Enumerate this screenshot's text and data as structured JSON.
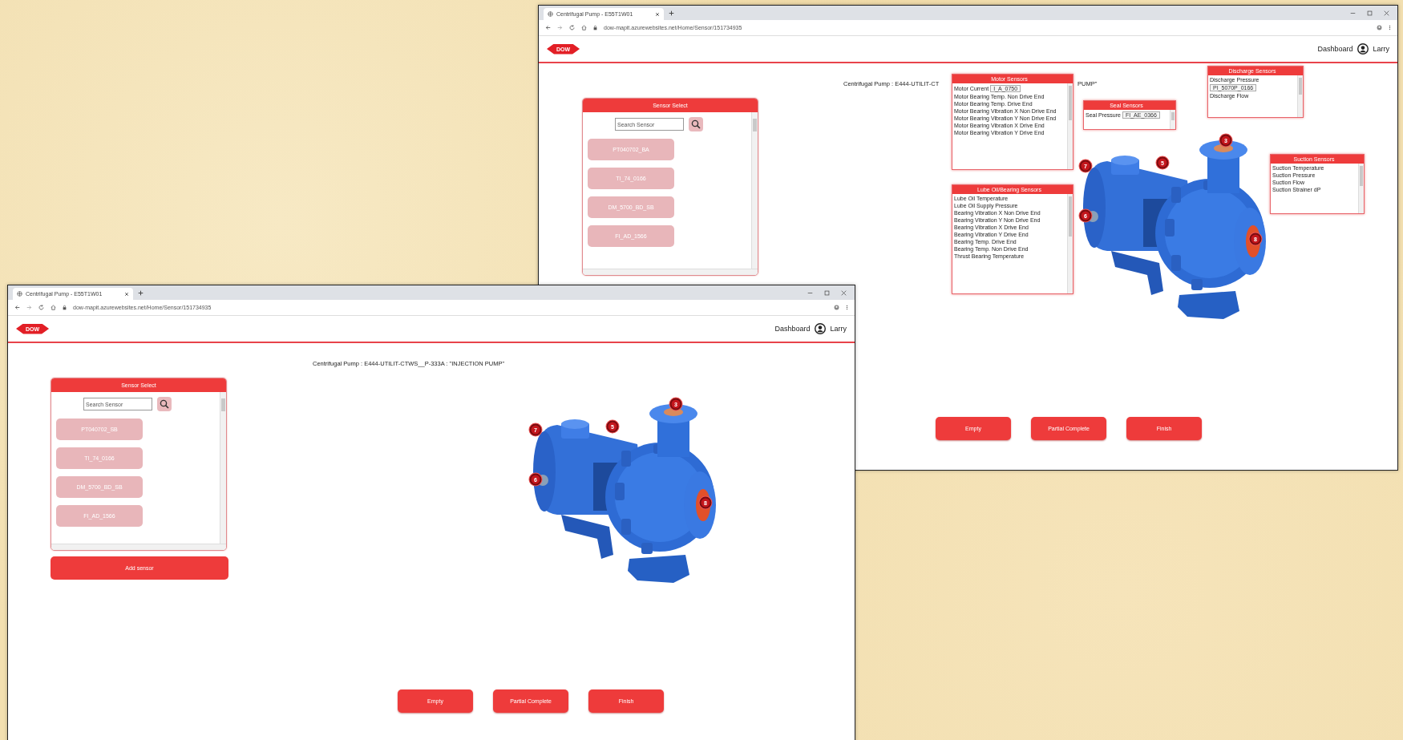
{
  "back_window": {
    "tab_title": "Centrifugal Pump - E55T1W01",
    "url": "dow-mapit.azurewebsites.net/Home/Sensor/151734935",
    "logo": "DOW",
    "nav_link": "Dashboard",
    "user_name": "Larry",
    "page_title": "Centrifugal Pump : E444-UTILIT-CT",
    "page_title_tail": "PUMP\"",
    "sensor_select": {
      "heading": "Sensor Select",
      "placeholder": "Search Sensor",
      "sensors": [
        "PT040702_BA",
        "TI_74_0166",
        "DM_5700_BD_SB",
        "FI_AD_1566"
      ]
    },
    "pump": {
      "markers": [
        "7",
        "5",
        "3",
        "6",
        "8"
      ],
      "panels": [
        {
          "title": "Motor Sensors",
          "items": [
            {
              "kind": "field",
              "label": "Motor Current",
              "value": "I_A_0750"
            },
            {
              "kind": "text",
              "label": "Motor Bearing Temp. Non Drive End"
            },
            {
              "kind": "text",
              "label": "Motor Bearing Temp. Drive End"
            },
            {
              "kind": "text",
              "label": "Motor Bearing Vibration X Non Drive End"
            },
            {
              "kind": "text",
              "label": "Motor Bearing Vibration Y Non Drive End"
            },
            {
              "kind": "text",
              "label": "Motor Bearing Vibration X Drive End"
            },
            {
              "kind": "text",
              "label": "Motor Bearing Vibration Y Drive End"
            }
          ]
        },
        {
          "title": "Seal Sensors",
          "items": [
            {
              "kind": "field",
              "label": "Seal Pressure",
              "value": "FI_AE_0366"
            }
          ]
        },
        {
          "title": "Discharge Sensors",
          "items": [
            {
              "kind": "field",
              "label": "Discharge Pressure",
              "value": "PI_5070P_0166"
            },
            {
              "kind": "text",
              "label": "Discharge Flow"
            }
          ]
        },
        {
          "title": "Suction Sensors",
          "items": [
            {
              "kind": "text",
              "label": "Suction Temperature"
            },
            {
              "kind": "text",
              "label": "Suction Pressure"
            },
            {
              "kind": "text",
              "label": "Suction Flow"
            },
            {
              "kind": "text",
              "label": "Suction Strainer dP"
            }
          ]
        },
        {
          "title": "Lube Oil/Bearing Sensors",
          "items": [
            {
              "kind": "text",
              "label": "Lube Oil Temperature"
            },
            {
              "kind": "text",
              "label": "Lube Oil Supply Pressure"
            },
            {
              "kind": "text",
              "label": "Bearing Vibration X Non Drive End"
            },
            {
              "kind": "text",
              "label": "Bearing Vibration Y Non Drive End"
            },
            {
              "kind": "text",
              "label": "Bearing Vibration X Drive End"
            },
            {
              "kind": "text",
              "label": "Bearing Vibration Y Drive End"
            },
            {
              "kind": "text",
              "label": "Bearing Temp. Drive End"
            },
            {
              "kind": "text",
              "label": "Bearing Temp. Non Drive End"
            },
            {
              "kind": "text",
              "label": "Thrust Bearing Temperature"
            }
          ]
        }
      ]
    },
    "buttons": [
      "Empty",
      "Partial Complete",
      "Finish"
    ]
  },
  "front_window": {
    "tab_title": "Centrifugal Pump - E55T1W01",
    "url": "dow-mapit.azurewebsites.net/Home/Sensor/151734935",
    "logo": "DOW",
    "nav_link": "Dashboard",
    "user_name": "Larry",
    "page_title": "Centrifugal Pump : E444-UTILIT-CTWS__P-333A : \"INJECTION PUMP\"",
    "sensor_select": {
      "heading": "Sensor Select",
      "placeholder": "Search Sensor",
      "sensors": [
        "PT040702_SB",
        "TI_74_0166",
        "DM_5700_BD_SB",
        "FI_AD_1566"
      ]
    },
    "add_sensor_button": "Add sensor",
    "pump": {
      "markers": [
        "7",
        "5",
        "3",
        "6",
        "8"
      ]
    },
    "buttons": [
      "Empty",
      "Partial Complete",
      "Finish"
    ]
  }
}
